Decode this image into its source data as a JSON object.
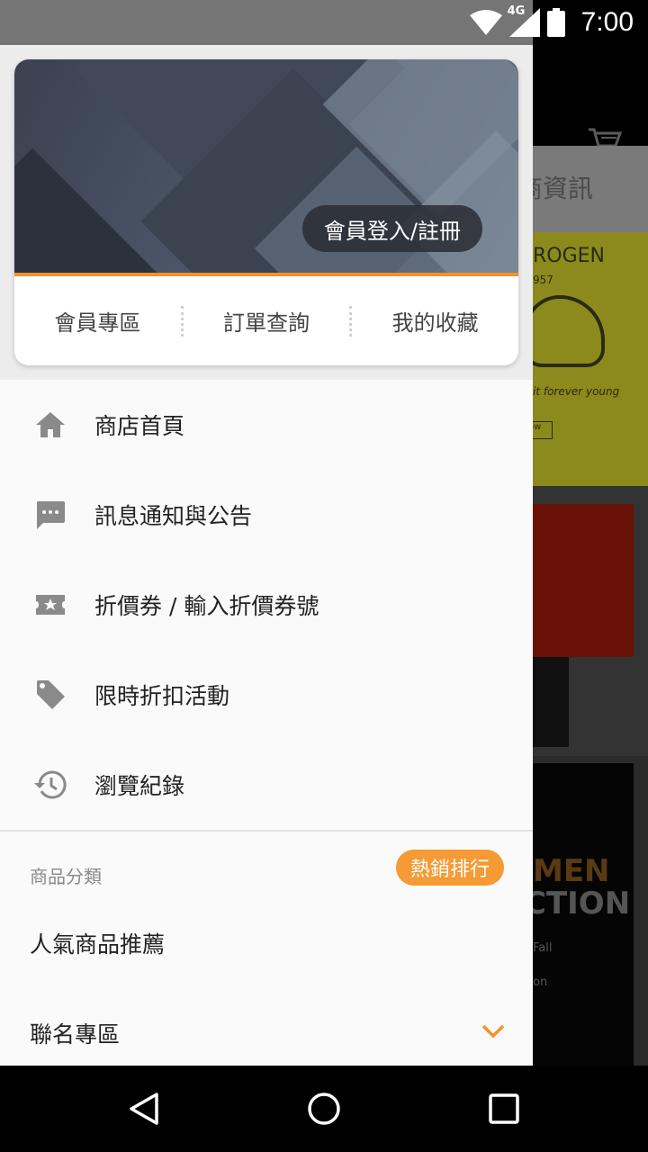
{
  "status_bar": {
    "network": "4G",
    "time": "7:00",
    "icons": [
      "wifi-icon",
      "cellular-icon",
      "battery-icon"
    ]
  },
  "background": {
    "tab_text": "商資訊",
    "banner1_brand": "ROGEN",
    "banner1_sub": "957",
    "banner1_script": "it forever young",
    "banner1_button": "ow",
    "banner3_line1": "MEN",
    "banner3_line2": "CTION",
    "banner3_line3": "Fall",
    "banner3_line4": "on"
  },
  "drawer": {
    "member_card": {
      "login_label": "會員登入/註冊",
      "links": [
        "會員專區",
        "訂單查詢",
        "我的收藏"
      ]
    },
    "menu": [
      {
        "icon": "home-icon",
        "label": "商店首頁"
      },
      {
        "icon": "message-icon",
        "label": "訊息通知與公告"
      },
      {
        "icon": "coupon-icon",
        "label": "折價券 / 輸入折價券號"
      },
      {
        "icon": "tag-icon",
        "label": "限時折扣活動"
      },
      {
        "icon": "history-icon",
        "label": "瀏覽紀錄"
      }
    ],
    "categories": {
      "title": "商品分類",
      "hot_badge": "熱銷排行",
      "items": [
        {
          "label": "人氣商品推薦"
        },
        {
          "label": "聯名專區",
          "expandable": true
        }
      ]
    }
  },
  "colors": {
    "accent": "#f0932b",
    "badge": "#f59a34",
    "icon_gray": "#8a8a8a"
  },
  "nav_bar": {
    "buttons": [
      "back-icon",
      "home-circle-icon",
      "recents-icon"
    ]
  }
}
